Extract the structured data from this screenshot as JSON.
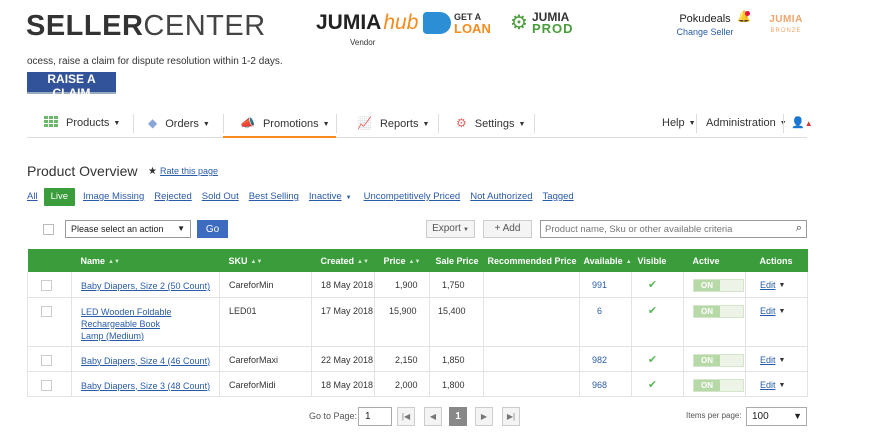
{
  "header": {
    "logo_bold": "SELLER",
    "logo_light": "CENTER",
    "vendor_hub": {
      "jumia": "JUMIA",
      "hub": "hub",
      "vendor": "Vendor"
    },
    "get_loan": {
      "line1": "GET A",
      "line2": "LOAN"
    },
    "jumia_prod": {
      "line1": "JUMIA",
      "line2": "PROD"
    },
    "user_name": "Pokudeals",
    "change_seller": "Change Seller",
    "badge": {
      "line1": "JUMIA",
      "line2": "BRONZE"
    }
  },
  "notice": {
    "text": "ocess, raise a claim for dispute resolution within 1-2 days.",
    "button": "RAISE A CLAIM"
  },
  "nav": {
    "items": [
      {
        "label": "Products",
        "icon": "grid-icon"
      },
      {
        "label": "Orders",
        "icon": "tag-icon"
      },
      {
        "label": "Promotions",
        "icon": "megaphone-icon"
      },
      {
        "label": "Reports",
        "icon": "chart-icon"
      },
      {
        "label": "Settings",
        "icon": "gear-icon"
      }
    ],
    "right": [
      {
        "label": "Help"
      },
      {
        "label": "Administration"
      }
    ]
  },
  "page": {
    "title": "Product Overview",
    "rate": "Rate this page"
  },
  "filters": [
    {
      "label": "All"
    },
    {
      "label": "Live"
    },
    {
      "label": "Image Missing"
    },
    {
      "label": "Rejected"
    },
    {
      "label": "Sold Out"
    },
    {
      "label": "Best Selling"
    },
    {
      "label": "Inactive"
    },
    {
      "label": "Uncompetitively Priced"
    },
    {
      "label": "Not Authorized"
    },
    {
      "label": "Tagged"
    }
  ],
  "actions": {
    "select_placeholder": "Please select an action",
    "go": "Go",
    "export": "Export",
    "add": "+ Add",
    "search_placeholder": "Product name, Sku or other available criteria"
  },
  "table": {
    "columns": [
      "Name",
      "SKU",
      "Created",
      "Price",
      "Sale Price",
      "Recommended Price",
      "Available",
      "Visible",
      "Active",
      "Actions"
    ],
    "rows": [
      {
        "name": "Baby Diapers, Size 2 (50 Count)",
        "sku": "CareforMin",
        "created": "18 May 2018",
        "price": "1,900",
        "sale_price": "1,750",
        "recommended": "",
        "available": "991",
        "active": "ON",
        "action": "Edit"
      },
      {
        "name": "LED Wooden Foldable Rechargeable Book Lamp (Medium)",
        "sku": "LED01",
        "created": "17 May 2018",
        "price": "15,900",
        "sale_price": "15,400",
        "recommended": "",
        "available": "6",
        "active": "ON",
        "action": "Edit"
      },
      {
        "name": "Baby Diapers, Size 4 (46 Count)",
        "sku": "CareforMaxi",
        "created": "22 May 2018",
        "price": "2,150",
        "sale_price": "1,850",
        "recommended": "",
        "available": "982",
        "active": "ON",
        "action": "Edit"
      },
      {
        "name": "Baby Diapers, Size 3 (48 Count)",
        "sku": "CareforMidi",
        "created": "18 May 2018",
        "price": "2,000",
        "sale_price": "1,800",
        "recommended": "",
        "available": "968",
        "active": "ON",
        "action": "Edit"
      }
    ]
  },
  "pagination": {
    "goto_label": "Go to Page:",
    "page_value": "1",
    "current": "1",
    "items_label": "Items per page:",
    "items_value": "100"
  },
  "colors": {
    "brand_orange": "#f68b1e",
    "table_header_green": "#3a9c3a",
    "claim_blue": "#32539a",
    "link_blue": "#2a5ba8"
  }
}
